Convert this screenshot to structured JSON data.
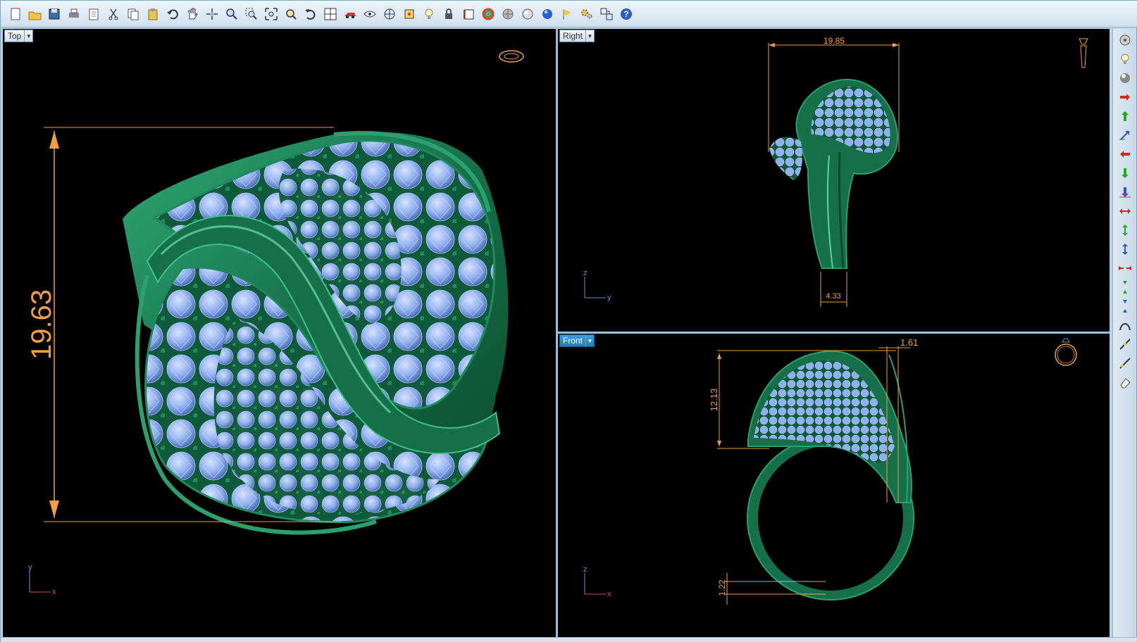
{
  "toolbar": {
    "icons": [
      "new-file-icon",
      "open-folder-icon",
      "save-icon",
      "print-icon",
      "page-setup-icon",
      "cut-icon",
      "copy-icon",
      "paste-icon",
      "undo-icon",
      "pan-hand-icon",
      "rotate-view-icon",
      "zoom-icon",
      "zoom-window-icon",
      "zoom-extents-icon",
      "zoom-selected-icon",
      "undo-view-icon",
      "four-viewports-icon",
      "car-icon",
      "hide-icon",
      "grid-snap-icon",
      "object-snap-icon",
      "light-bulb-icon",
      "lock-icon",
      "book-icon",
      "color-wheel-icon",
      "sphere-matte-icon",
      "sphere-shaded-icon",
      "sphere-blue-icon",
      "flag-icon",
      "settings-gears-icon",
      "group-icon",
      "help-icon"
    ]
  },
  "sidetools": {
    "icons": [
      "film-reel-icon",
      "light-bulb-icon",
      "shaded-sphere-icon",
      "arrow-right-red-icon",
      "arrow-up-green-icon",
      "arrow-axis-blue-icon",
      "arrow-left-red-icon",
      "arrow-down-green-icon",
      "arrow-down-blue-icon",
      "arrows-horizontal-red-icon",
      "arrows-vertical-green-icon",
      "arrows-vertical-blue-icon",
      "arrows-inward-red-icon",
      "arrows-inward-green-icon",
      "arrows-inward-blue-icon",
      "curve-tool-icon",
      "line-tool-icon",
      "line-tool-2-icon",
      "eraser-icon"
    ]
  },
  "viewports": {
    "top": {
      "label": "Top",
      "dimension": "19.63",
      "axis_a": "y",
      "axis_b": "x"
    },
    "right": {
      "label": "Right",
      "dim_width": "19.85",
      "dim_shank": "4.33",
      "axis_a": "z",
      "axis_b": "y"
    },
    "front": {
      "label": "Front",
      "dim_height": "12.13",
      "dim_top": "1.61",
      "dim_bottom": "1.22",
      "axis_a": "z",
      "axis_b": "x"
    }
  },
  "colors": {
    "viewport_bg": "#000000",
    "metal": "#1e7a55",
    "gem": "#8fb0ee",
    "dimension": "#f0a040",
    "active_tab": "#2f8fca"
  }
}
